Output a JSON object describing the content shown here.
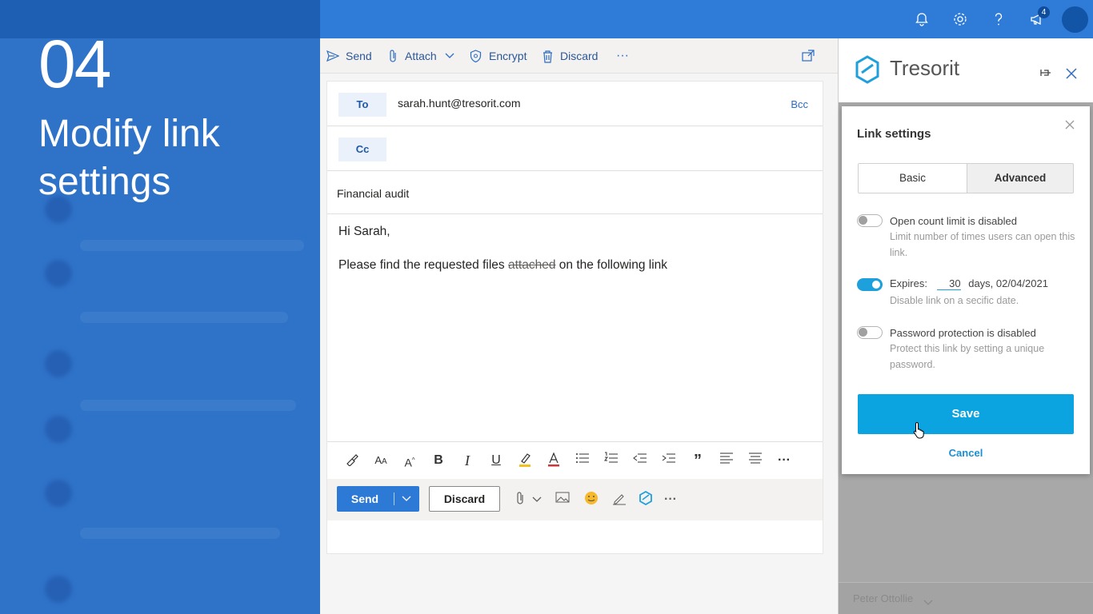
{
  "tutorial": {
    "step_number": "04",
    "step_title": "Modify link settings"
  },
  "topbar": {
    "icons": [
      "bell-icon",
      "gear-icon",
      "help-icon",
      "megaphone-icon"
    ],
    "notification_count": "4",
    "accent": "#2e7bd8"
  },
  "compose": {
    "toolbar": {
      "send": "Send",
      "attach": "Attach",
      "encrypt": "Encrypt",
      "discard": "Discard",
      "more": "···"
    },
    "to_label": "To",
    "to_value": "sarah.hunt@tresorit.com",
    "cc_label": "Cc",
    "bcc_label": "Bcc",
    "subject": "Financial audit",
    "body_greeting": "Hi Sarah,",
    "body_line_1": "Please find the requested files",
    "body_strike": "attached",
    "body_line_2": "on the following link",
    "send_button": "Send",
    "discard_button": "Discard",
    "more": "···"
  },
  "pane": {
    "brand": "Tresorit",
    "user_name": "Peter Ottollie",
    "brand_color": "#1ea0dc"
  },
  "dialog": {
    "title": "Link settings",
    "tab_basic": "Basic",
    "tab_advanced": "Advanced",
    "open_count": {
      "title": "Open count limit is disabled",
      "desc": "Limit number of times users can open this link.",
      "enabled": false
    },
    "expires": {
      "label": "Expires:",
      "days_value": "30",
      "suffix": "days, 02/04/2021",
      "desc": "Disable link on a secific date.",
      "enabled": true
    },
    "password": {
      "title": "Password protection is disabled",
      "desc": "Protect this link by setting a unique password.",
      "enabled": false
    },
    "save": "Save",
    "cancel": "Cancel",
    "save_color": "#0ba4e0"
  }
}
